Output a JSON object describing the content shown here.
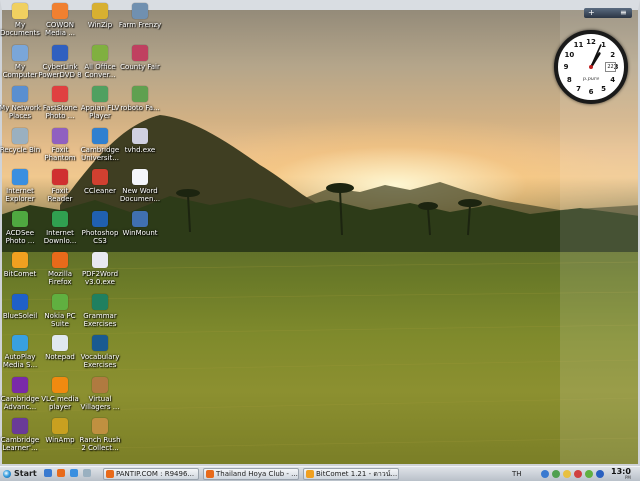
{
  "desktop_icons": [
    {
      "label": "My\nDocuments",
      "icon": "folder-icon",
      "color": "#f0d060"
    },
    {
      "label": "My\nComputer",
      "icon": "computer-icon",
      "color": "#7aa6d8"
    },
    {
      "label": "My Network\nPlaces",
      "icon": "network-icon",
      "color": "#5a8fd0"
    },
    {
      "label": "Recycle Bin",
      "icon": "recycle-bin-icon",
      "color": "#9ab0c0"
    },
    {
      "label": "Internet\nExplorer",
      "icon": "internet-explorer-icon",
      "color": "#3a8fe0"
    },
    {
      "label": "ACDSee\nPhoto ...",
      "icon": "acdsee-icon",
      "color": "#4fa840"
    },
    {
      "label": "BitComet",
      "icon": "bitcomet-icon",
      "color": "#f0a020"
    },
    {
      "label": "BlueSoleil",
      "icon": "bluetooth-icon",
      "color": "#1f60c8"
    },
    {
      "label": "AutoPlay\nMedia S...",
      "icon": "autoplay-icon",
      "color": "#38a0e0"
    },
    {
      "label": "Cambridge\nAdvanc...",
      "icon": "cambridge-book-icon",
      "color": "#7a2aa8"
    },
    {
      "label": "Cambridge\nLearner'...",
      "icon": "cambridge-learner-icon",
      "color": "#6a3a98"
    },
    {
      "label": "COWON\nMedia ...",
      "icon": "cowon-icon",
      "color": "#f08030"
    },
    {
      "label": "CyberLink\nPowerDVD 8",
      "icon": "powerdvd-icon",
      "color": "#3060c0"
    },
    {
      "label": "FastStone\nPhoto ...",
      "icon": "faststone-icon",
      "color": "#e04040"
    },
    {
      "label": "Foxit\nPhantom",
      "icon": "foxit-phantom-icon",
      "color": "#9060c0"
    },
    {
      "label": "Foxit\nReader",
      "icon": "foxit-reader-icon",
      "color": "#d03030"
    },
    {
      "label": "Internet\nDownlo...",
      "icon": "idm-icon",
      "color": "#30a050"
    },
    {
      "label": "Mozilla\nFirefox",
      "icon": "firefox-icon",
      "color": "#e86a1a"
    },
    {
      "label": "Nokia PC\nSuite",
      "icon": "nokia-icon",
      "color": "#60b040"
    },
    {
      "label": "Notepad",
      "icon": "notepad-icon",
      "color": "#e0e8f0"
    },
    {
      "label": "VLC media\nplayer",
      "icon": "vlc-icon",
      "color": "#f08a10"
    },
    {
      "label": "WinAmp",
      "icon": "winamp-icon",
      "color": "#c8a020"
    },
    {
      "label": "WinZip",
      "icon": "winzip-icon",
      "color": "#d8b030"
    },
    {
      "label": "All Office\nConver...",
      "icon": "office-converter-icon",
      "color": "#80b040"
    },
    {
      "label": "Appian FLV\nPlayer",
      "icon": "flv-player-icon",
      "color": "#50a060"
    },
    {
      "label": "Cambridge\nUniversit...",
      "icon": "cambridge-globe-icon",
      "color": "#3080d0"
    },
    {
      "label": "CCleaner",
      "icon": "ccleaner-icon",
      "color": "#d04030"
    },
    {
      "label": "Photoshop\nCS3",
      "icon": "photoshop-icon",
      "color": "#2060b0"
    },
    {
      "label": "PDF2Word\nv3.0.exe",
      "icon": "pdf2word-icon",
      "color": "#e8e8f0"
    },
    {
      "label": "Grammar\nExercises",
      "icon": "grammar-icon",
      "color": "#208060"
    },
    {
      "label": "Vocabulary\nExercises",
      "icon": "vocabulary-icon",
      "color": "#1a5a90"
    },
    {
      "label": "Virtual\nVillagers ...",
      "icon": "virtual-villagers-icon",
      "color": "#b07a40"
    },
    {
      "label": "Ranch Rush\n2 Collect...",
      "icon": "ranch-rush-icon",
      "color": "#c09040"
    },
    {
      "label": "Farm Frenzy",
      "icon": "farm-frenzy-icon",
      "color": "#7090b0"
    },
    {
      "label": "County Fair",
      "icon": "county-fair-icon",
      "color": "#c04060"
    },
    {
      "label": "roboto Fa...",
      "icon": "roboto-icon",
      "color": "#60a050"
    },
    {
      "label": "tvhd.exe",
      "icon": "tvhd-icon",
      "color": "#d0d0e0"
    },
    {
      "label": "New Word\nDocumen...",
      "icon": "word-document-icon",
      "color": "#f4f6fa"
    },
    {
      "label": "WinMount",
      "icon": "winmount-icon",
      "color": "#4070b0"
    }
  ],
  "clock_gadget": {
    "toolbar": {
      "add": "+",
      "menu": "≡"
    },
    "numbers": [
      "12",
      "1",
      "2",
      "3",
      "4",
      "5",
      "6",
      "7",
      "8",
      "9",
      "10",
      "11"
    ],
    "brand": "p.pure",
    "date": "22",
    "hour": 1,
    "minute": 4
  },
  "taskbar": {
    "start_label": "Start",
    "tasks": [
      {
        "label": "PANTIP.COM : R9496...",
        "icon": "firefox-task-icon",
        "color": "#e86a1a"
      },
      {
        "label": "Thailand Hoya Club - ...",
        "icon": "firefox-task-icon",
        "color": "#e86a1a"
      },
      {
        "label": "BitComet 1.21 - ดาวน์...",
        "icon": "bitcomet-task-icon",
        "color": "#f0a020"
      }
    ],
    "language": "TH",
    "time": "13:0",
    "ampm": "PM"
  }
}
